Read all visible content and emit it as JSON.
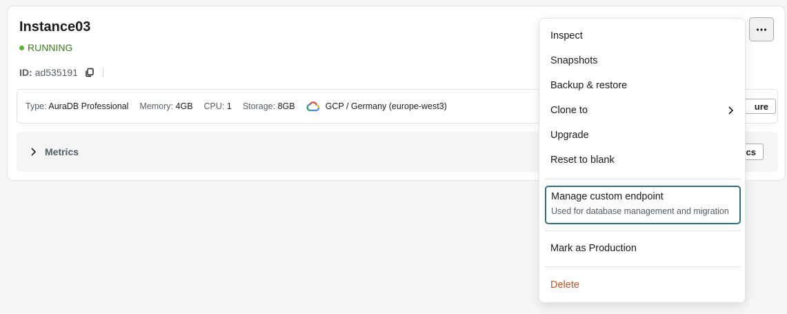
{
  "instance": {
    "name": "Instance03",
    "status": "RUNNING",
    "id_label": "ID:",
    "id_value": "ad535191"
  },
  "props": {
    "type_label": "Type:",
    "type_value": "AuraDB Professional",
    "memory_label": "Memory:",
    "memory_value": "4GB",
    "cpu_label": "CPU:",
    "cpu_value": "1",
    "storage_label": "Storage:",
    "storage_value": "8GB",
    "region": "GCP / Germany (europe-west3)",
    "configure_partial": "ure"
  },
  "metrics": {
    "label": "Metrics",
    "button_partial": "cs"
  },
  "menu": {
    "inspect": "Inspect",
    "snapshots": "Snapshots",
    "backup": "Backup & restore",
    "clone": "Clone to",
    "upgrade": "Upgrade",
    "reset": "Reset to blank",
    "endpoint_title": "Manage custom endpoint",
    "endpoint_desc": "Used for database management and migration",
    "production": "Mark as Production",
    "delete": "Delete"
  },
  "colors": {
    "running": "#3f7824",
    "delete": "#c4501f",
    "focus": "#2e6c7c"
  }
}
